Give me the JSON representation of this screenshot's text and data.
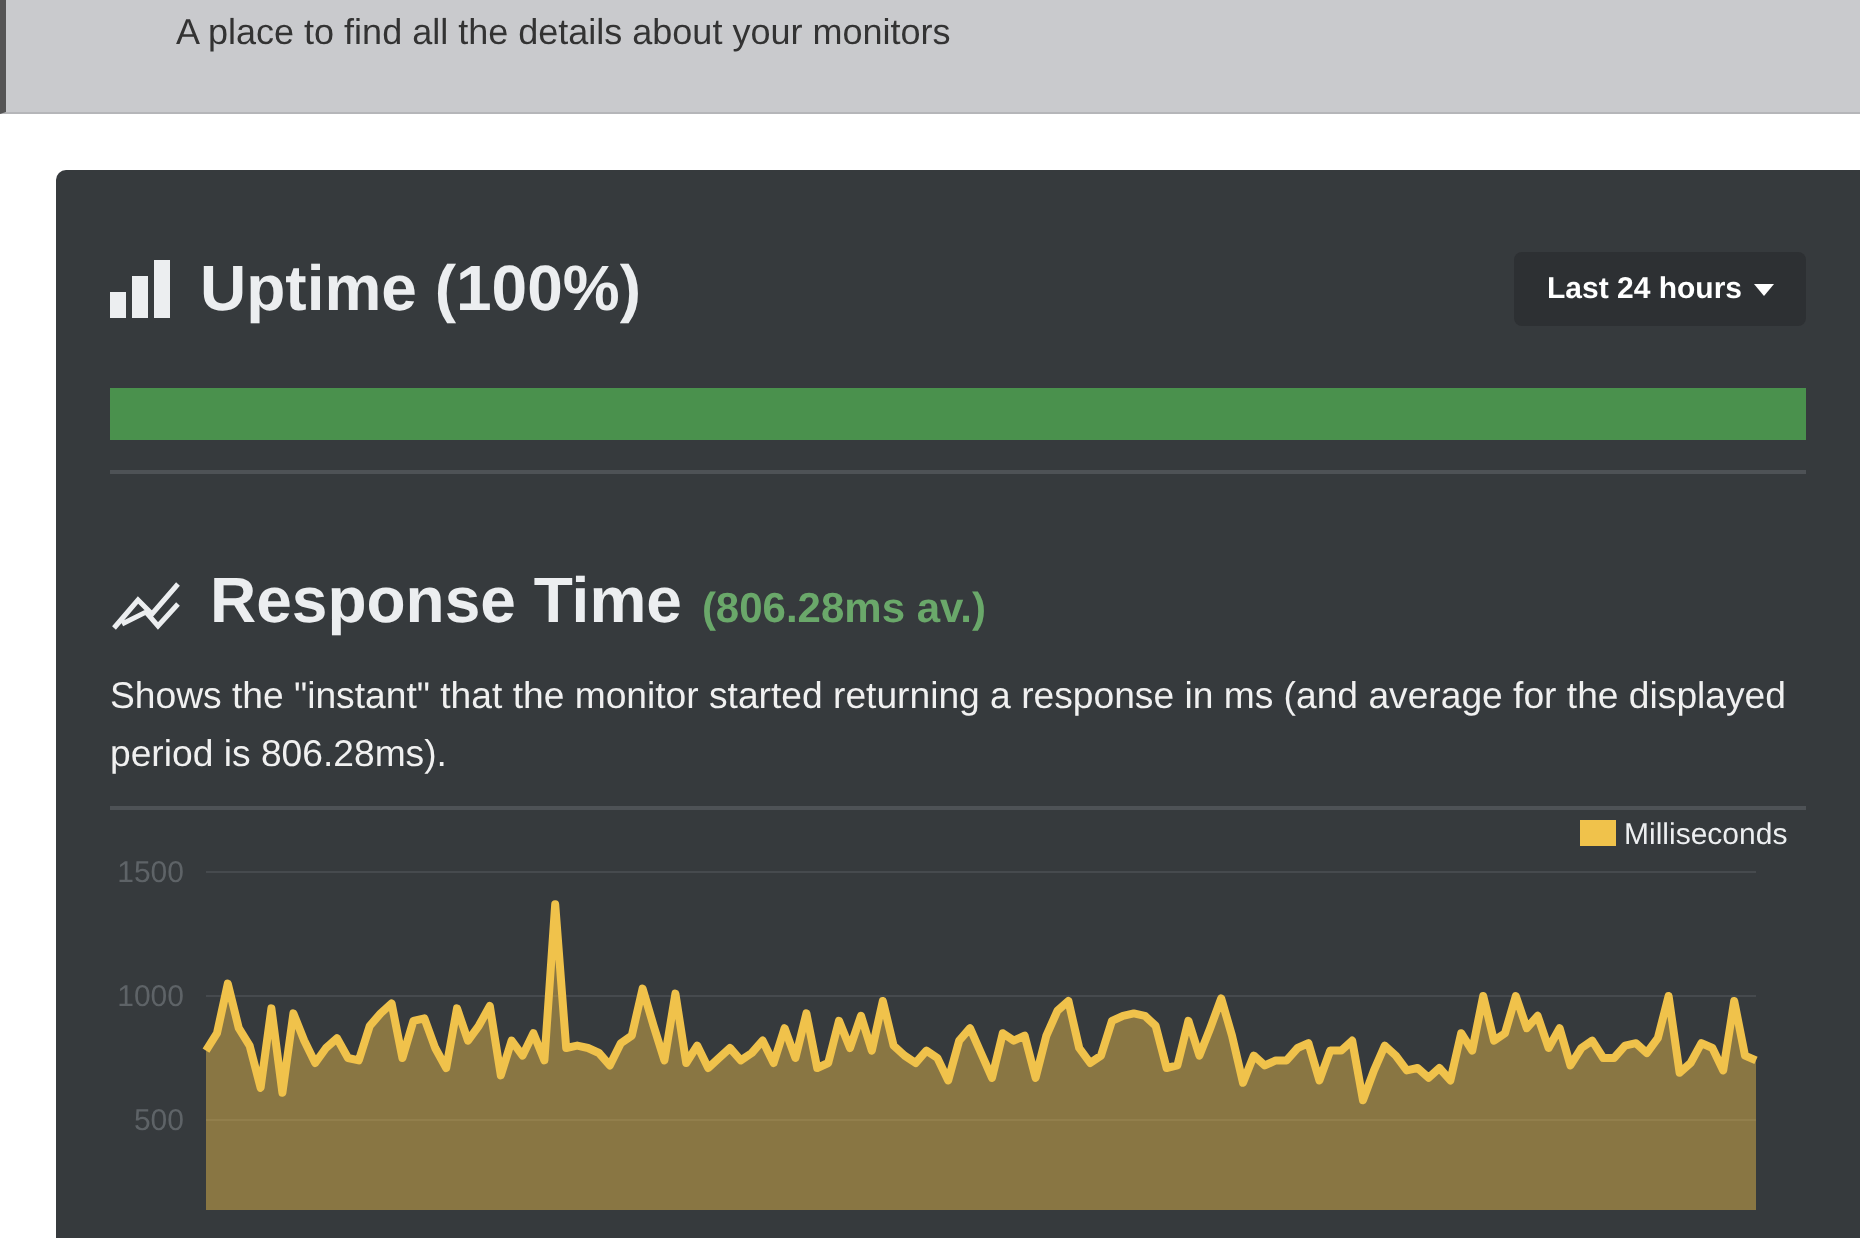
{
  "header": {
    "subtitle": "A place to find all the details about your monitors"
  },
  "uptime": {
    "title": "Uptime (100%)",
    "period_button": "Last 24 hours",
    "level": 1
  },
  "response_time": {
    "title": "Response Time",
    "average": "(806.28ms av.)",
    "description": "Shows the \"instant\" that the monitor started returning a response in ms (and average for the displayed period is 806.28ms).",
    "chart_data": {
      "type": "area",
      "ylim": [
        0,
        1500
      ],
      "yticks": [
        500,
        1000,
        1500
      ],
      "series": [
        {
          "name": "Milliseconds",
          "color": "#f0c24b",
          "values": [
            780,
            850,
            1050,
            870,
            800,
            630,
            950,
            610,
            930,
            820,
            730,
            790,
            830,
            750,
            740,
            880,
            930,
            970,
            750,
            900,
            910,
            790,
            710,
            950,
            820,
            880,
            960,
            680,
            820,
            760,
            850,
            740,
            1370,
            790,
            800,
            790,
            770,
            720,
            810,
            840,
            1030,
            880,
            740,
            1010,
            730,
            800,
            710,
            750,
            790,
            740,
            770,
            820,
            730,
            870,
            750,
            930,
            710,
            730,
            900,
            790,
            920,
            780,
            980,
            800,
            760,
            730,
            780,
            750,
            660,
            820,
            870,
            770,
            670,
            850,
            820,
            840,
            670,
            840,
            940,
            980,
            790,
            730,
            760,
            900,
            920,
            930,
            920,
            880,
            710,
            720,
            900,
            760,
            870,
            990,
            840,
            650,
            760,
            720,
            740,
            740,
            790,
            810,
            660,
            780,
            780,
            820,
            580,
            700,
            800,
            760,
            700,
            710,
            670,
            710,
            660,
            850,
            780,
            1000,
            820,
            850,
            1000,
            870,
            920,
            790,
            870,
            720,
            790,
            820,
            750,
            750,
            800,
            810,
            770,
            830,
            1000,
            690,
            730,
            810,
            790,
            700,
            980,
            760,
            740
          ]
        }
      ]
    }
  }
}
